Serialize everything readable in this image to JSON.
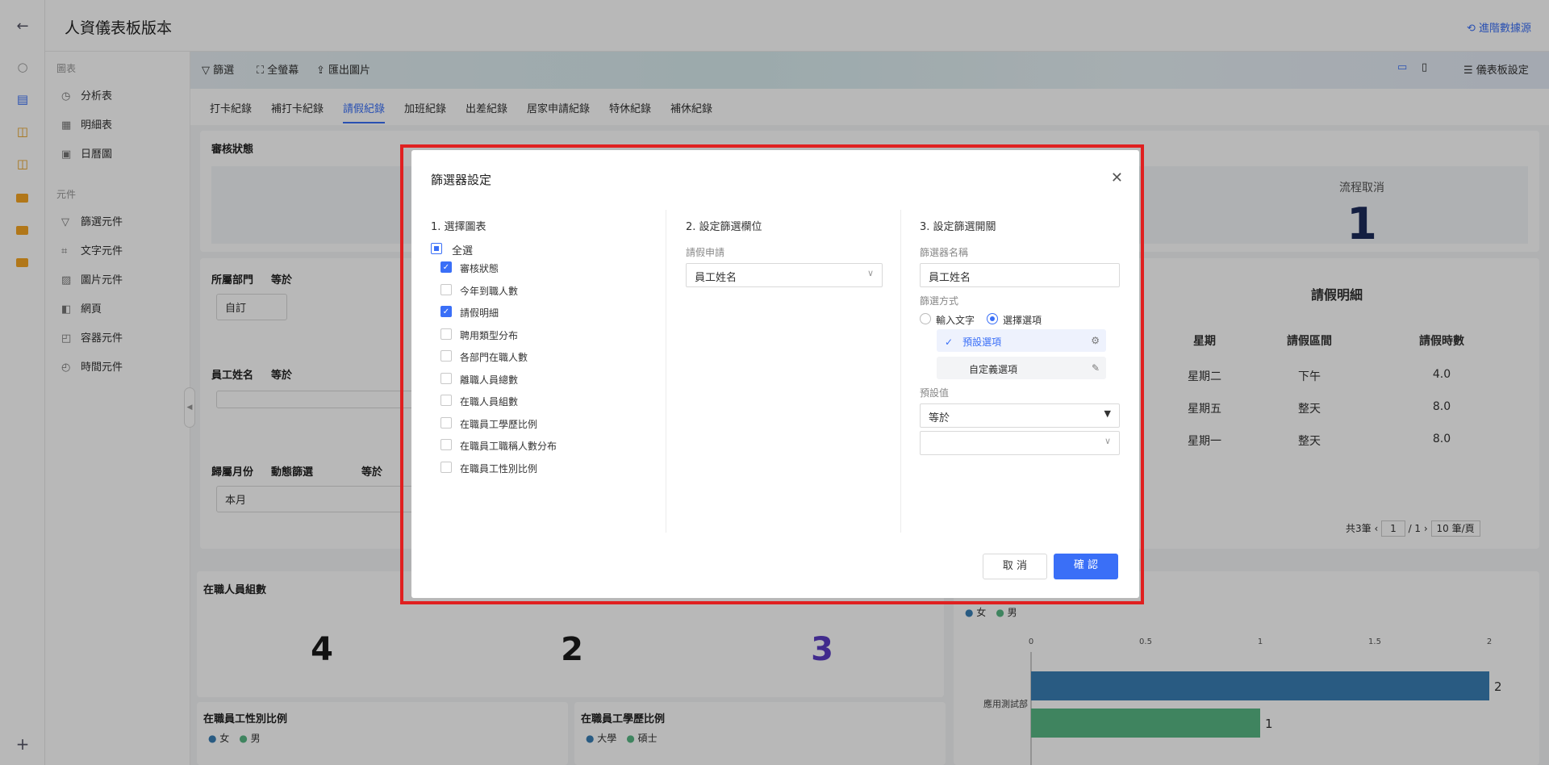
{
  "app": {
    "title": "人資儀表板版本",
    "advanced_label": "進階數據源"
  },
  "sidebar": {
    "section_charts": "圖表",
    "chart_items": [
      {
        "icon": "clock-icon",
        "label": "分析表"
      },
      {
        "icon": "table-icon",
        "label": "明細表"
      },
      {
        "icon": "calendar-icon",
        "label": "日曆圖"
      }
    ],
    "section_components": "元件",
    "component_items": [
      {
        "icon": "filter-icon",
        "label": "篩選元件"
      },
      {
        "icon": "text-icon",
        "label": "文字元件"
      },
      {
        "icon": "image-icon",
        "label": "圖片元件"
      },
      {
        "icon": "web-icon",
        "label": "網頁"
      },
      {
        "icon": "container-icon",
        "label": "容器元件"
      },
      {
        "icon": "time-icon",
        "label": "時間元件"
      }
    ]
  },
  "toolbar": {
    "filter": "篩選",
    "fullscreen": "全螢幕",
    "export": "匯出圖片",
    "settings": "儀表板設定"
  },
  "tabs": [
    "打卡紀錄",
    "補打卡紀錄",
    "請假紀錄",
    "加班紀錄",
    "出差紀錄",
    "居家申請紀錄",
    "特休紀錄",
    "補休紀錄"
  ],
  "background": {
    "review_title": "審核狀態",
    "cancel_label": "流程取消",
    "cancel_value": "1",
    "dept_filter": {
      "label": "所屬部門",
      "op": "等於",
      "value": "自訂"
    },
    "name_filter": {
      "label": "員工姓名",
      "op": "等於"
    },
    "month_filter": {
      "label": "歸屬月份",
      "mode": "動態篩選",
      "op": "等於",
      "value": "本月"
    },
    "leave_detail": {
      "title": "請假明細",
      "headers": [
        "星期",
        "請假區間",
        "請假時數"
      ],
      "rows": [
        [
          "星期二",
          "下午",
          "4.0"
        ],
        [
          "星期五",
          "整天",
          "8.0"
        ],
        [
          "星期一",
          "整天",
          "8.0"
        ]
      ],
      "pager": {
        "total": "共3筆",
        "page": "1",
        "pages": "/ 1",
        "size": "10 筆/頁"
      }
    },
    "employee_count": {
      "title": "在職人員組數",
      "values": [
        "4",
        "2",
        "3"
      ]
    },
    "gender_ratio": {
      "title": "在職員工性別比例",
      "legend": [
        "女",
        "男"
      ]
    },
    "edu_ratio": {
      "title": "在職員工學歷比例",
      "legend": [
        "大學",
        "碩士"
      ]
    },
    "bar_chart": {
      "legend": [
        "女",
        "男"
      ],
      "ticks": [
        "0",
        "0.5",
        "1",
        "1.5",
        "2"
      ],
      "category": "應用測試部"
    }
  },
  "chart_data": {
    "type": "bar",
    "categories": [
      "應用測試部"
    ],
    "series": [
      {
        "name": "女",
        "values": [
          2
        ]
      },
      {
        "name": "男",
        "values": [
          1
        ]
      }
    ],
    "xlim": [
      0,
      2
    ],
    "colors": [
      "#3a7fb5",
      "#58b884"
    ],
    "legend_position": "top-left"
  },
  "modal": {
    "title": "篩選器設定",
    "step1": {
      "title": "1. 選擇圖表",
      "select_all": "全選",
      "items": [
        {
          "label": "審核狀態",
          "checked": true
        },
        {
          "label": "今年到職人數",
          "checked": false
        },
        {
          "label": "請假明細",
          "checked": true
        },
        {
          "label": "聘用類型分布",
          "checked": false
        },
        {
          "label": "各部門在職人數",
          "checked": false
        },
        {
          "label": "離職人員總數",
          "checked": false
        },
        {
          "label": "在職人員組數",
          "checked": false
        },
        {
          "label": "在職員工學歷比例",
          "checked": false
        },
        {
          "label": "在職員工職稱人數分布",
          "checked": false
        },
        {
          "label": "在職員工性別比例",
          "checked": false
        }
      ]
    },
    "step2": {
      "title": "2. 設定篩選欄位",
      "field_label": "請假申請",
      "field_value": "員工姓名"
    },
    "step3": {
      "title": "3. 設定篩選開關",
      "name_label": "篩選器名稱",
      "name_value": "員工姓名",
      "mode_label": "篩選方式",
      "mode_text": "輸入文字",
      "mode_select": "選擇選項",
      "opt_default": "預設選項",
      "opt_custom": "自定義選項",
      "default_label": "預設值",
      "default_op": "等於"
    },
    "cancel": "取 消",
    "confirm": "確 認"
  }
}
